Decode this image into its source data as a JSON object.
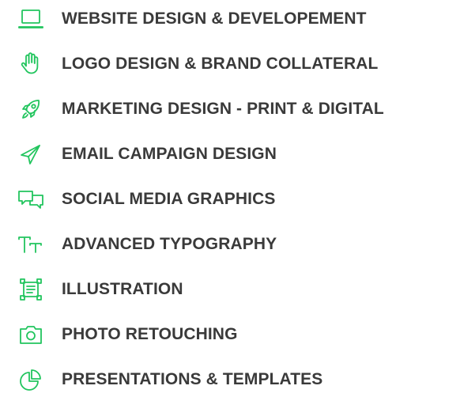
{
  "colors": {
    "accent": "#22c55e",
    "text": "#3a3a3a",
    "background": "#ffffff"
  },
  "services": [
    {
      "icon": "laptop-icon",
      "label": "WEBSITE DESIGN & DEVELOPEMENT"
    },
    {
      "icon": "hand-icon",
      "label": "LOGO DESIGN & BRAND COLLATERAL"
    },
    {
      "icon": "rocket-icon",
      "label": "MARKETING DESIGN - PRINT & DIGITAL"
    },
    {
      "icon": "paper-plane-icon",
      "label": "EMAIL CAMPAIGN DESIGN"
    },
    {
      "icon": "chat-bubbles-icon",
      "label": "SOCIAL MEDIA GRAPHICS"
    },
    {
      "icon": "text-size-icon",
      "label": "ADVANCED TYPOGRAPHY"
    },
    {
      "icon": "vector-frame-icon",
      "label": "ILLUSTRATION"
    },
    {
      "icon": "camera-icon",
      "label": "PHOTO RETOUCHING"
    },
    {
      "icon": "pie-chart-icon",
      "label": "PRESENTATIONS & TEMPLATES"
    }
  ]
}
